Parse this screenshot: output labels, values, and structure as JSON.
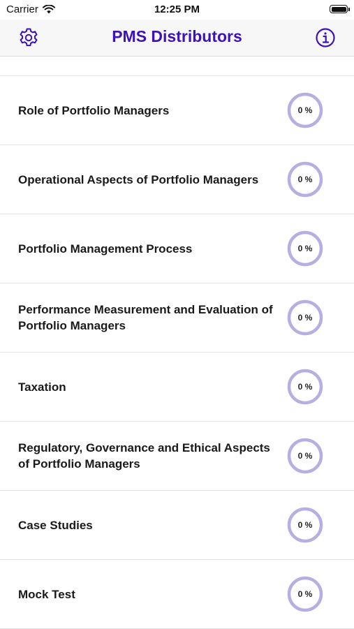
{
  "status_bar": {
    "carrier": "Carrier",
    "time": "12:25 PM"
  },
  "nav": {
    "title": "PMS Distributors",
    "left_icon": "gear-icon",
    "right_icon": "info-icon",
    "accent_color": "#3d12b8"
  },
  "ring_color": "#b9aee2",
  "chapters": [
    {
      "title": "Role of Portfolio Managers",
      "progress": 0,
      "progress_label": "0 %"
    },
    {
      "title": "Operational Aspects of Portfolio Managers",
      "progress": 0,
      "progress_label": "0 %"
    },
    {
      "title": "Portfolio Management Process",
      "progress": 0,
      "progress_label": "0 %"
    },
    {
      "title": "Performance Measurement and Evaluation of Portfolio Managers",
      "progress": 0,
      "progress_label": "0 %"
    },
    {
      "title": "Taxation",
      "progress": 0,
      "progress_label": "0 %"
    },
    {
      "title": "Regulatory, Governance and Ethical Aspects of Portfolio Managers",
      "progress": 0,
      "progress_label": "0 %"
    },
    {
      "title": "Case Studies",
      "progress": 0,
      "progress_label": "0 %"
    },
    {
      "title": "Mock Test",
      "progress": 0,
      "progress_label": "0 %"
    }
  ]
}
